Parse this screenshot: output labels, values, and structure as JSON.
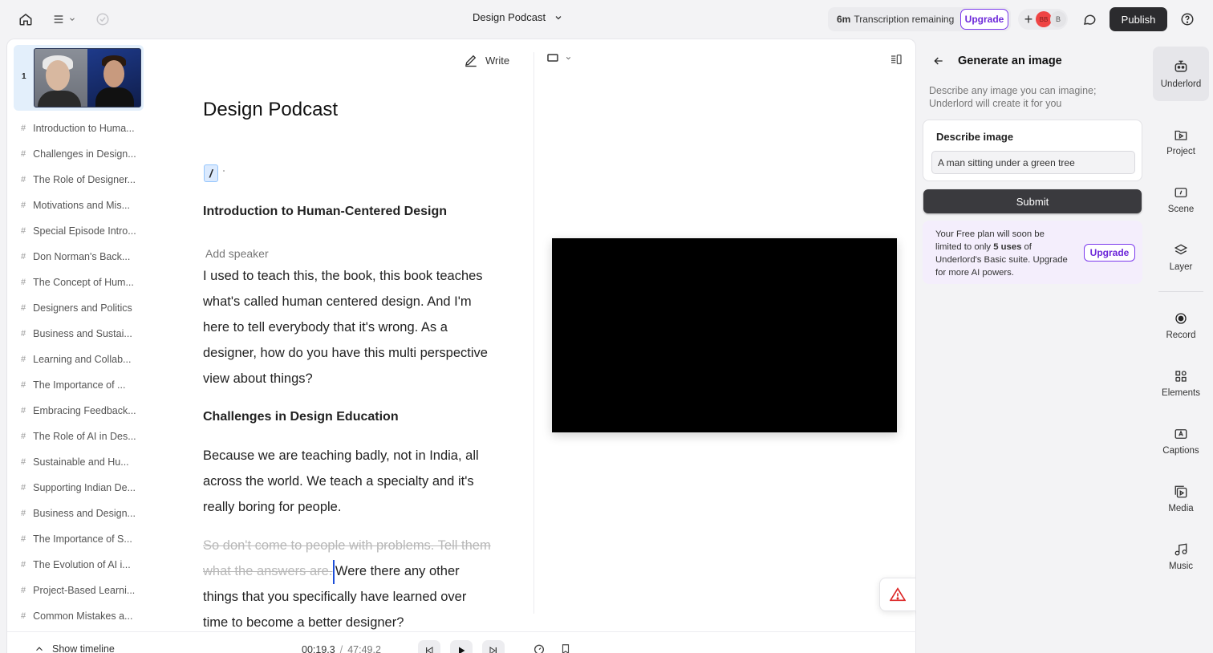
{
  "topbar": {
    "project_title": "Design Podcast",
    "transcription_amount": "6m",
    "transcription_text": "Transcription remaining",
    "upgrade_label": "Upgrade",
    "avatar_initials_1": "BB",
    "avatar_initials_2": "B",
    "publish_label": "Publish"
  },
  "scenes": {
    "scene_number": "1",
    "chapters": [
      "Introduction to Huma...",
      "Challenges in Design...",
      "The Role of Designer...",
      "Motivations and Mis...",
      "Special Episode Intro...",
      "Don Norman's Back...",
      "The Concept of Hum...",
      "Designers and Politics",
      "Business and Sustai...",
      "Learning and Collab...",
      "The Importance of ...",
      "Embracing Feedback...",
      "The Role of AI in Des...",
      "Sustainable and Hu...",
      "Supporting Indian De...",
      "Business and Design...",
      "The Importance of S...",
      "The Evolution of AI i...",
      "Project-Based Learni...",
      "Common Mistakes a..."
    ]
  },
  "editor": {
    "write_label": "Write",
    "doc_title": "Design Podcast",
    "slash": "/",
    "heading_1": "Introduction to Human-Centered Design",
    "add_speaker": "Add speaker",
    "para_1": "I used to teach this, the book, this book teaches what's called human centered design. And I'm here to tell everybody that it's wrong. As a designer, how do you have this multi perspective view about things?",
    "heading_2": "Challenges in Design Education",
    "para_2": "Because we are teaching badly, not in India, all across the world. We teach a specialty and it's really boring for people.",
    "para_3_struck": "So don't come to people with problems. Tell them what the answers are.",
    "para_3_rest": "Were there any other things that you specifically have learned over time to become a better designer?"
  },
  "transport": {
    "show_timeline": "Show timeline",
    "current_time": "00:19.3",
    "separator": "/",
    "total_time": "47:49.2"
  },
  "generate": {
    "title": "Generate an image",
    "subtitle": "Describe any image you can imagine; Underlord will create it for you",
    "describe_label": "Describe image",
    "prompt_value": "A man sitting under a green tree",
    "submit_label": "Submit",
    "free_1": "Your Free plan will soon be limited to only ",
    "free_bold": "5 uses",
    "free_2": " of Underlord's Basic suite. Upgrade for more AI powers.",
    "upgrade_label": "Upgrade"
  },
  "rail": {
    "underlord": "Underlord",
    "project": "Project",
    "scene": "Scene",
    "layer": "Layer",
    "record": "Record",
    "elements": "Elements",
    "captions": "Captions",
    "media": "Media",
    "music": "Music"
  },
  "colors": {
    "accent_purple": "#7c3aed",
    "publish_bg": "#2b2b2e",
    "selection_blue": "#dbeafe",
    "warning_red": "#dc2626"
  }
}
